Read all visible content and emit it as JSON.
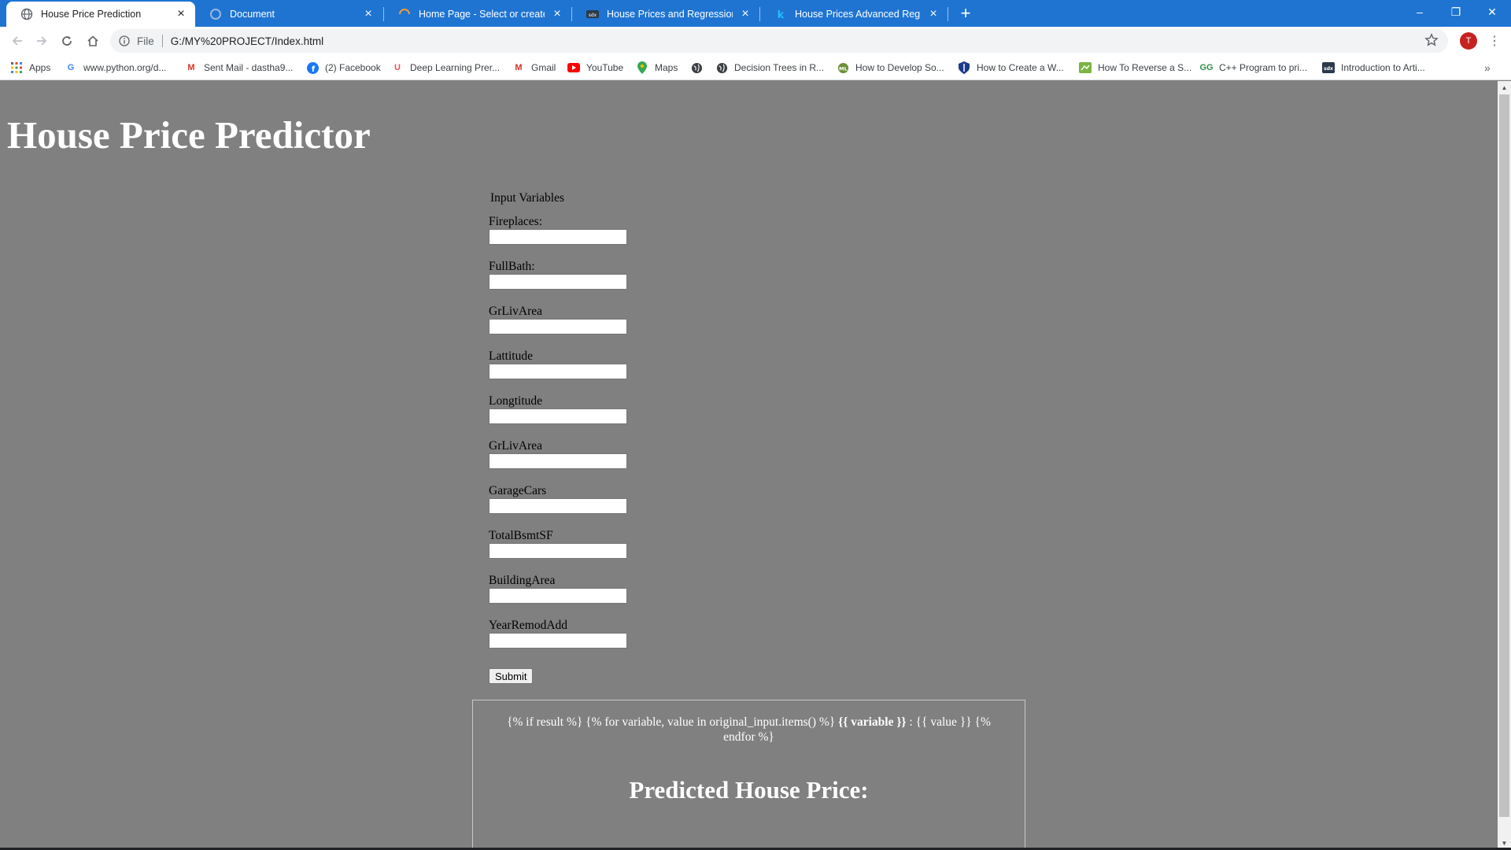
{
  "browser": {
    "tabs": [
      {
        "title": "House Price Prediction",
        "active": true,
        "icon": "globe-icon"
      },
      {
        "title": "Document",
        "active": false,
        "icon": "document-icon"
      },
      {
        "title": "Home Page - Select or create a n",
        "active": false,
        "icon": "loading-icon"
      },
      {
        "title": "House Prices and Regressions. In",
        "active": false,
        "icon": "sdx-icon"
      },
      {
        "title": "House Prices Advanced Regressi",
        "active": false,
        "icon": "kaggle-icon"
      }
    ],
    "new_tab": "+",
    "window_controls": {
      "minimize": "–",
      "restore": "❐",
      "close": "✕"
    },
    "address": {
      "scheme": "File",
      "url": "G:/MY%20PROJECT/Index.html"
    },
    "profile_initial": "T",
    "bookmarks": [
      {
        "label": "Apps",
        "icon": "apps-grid-icon"
      },
      {
        "label": "www.python.org/d...",
        "icon": "google-icon"
      },
      {
        "label": "Sent Mail - dastha9...",
        "icon": "gmail-icon"
      },
      {
        "label": "(2) Facebook",
        "icon": "facebook-icon"
      },
      {
        "label": "Deep Learning Prer...",
        "icon": "udemy-icon"
      },
      {
        "label": "Gmail",
        "icon": "gmail-icon"
      },
      {
        "label": "YouTube",
        "icon": "youtube-icon"
      },
      {
        "label": "Maps",
        "icon": "maps-pin-icon"
      },
      {
        "label": "",
        "icon": "globe-icon"
      },
      {
        "label": "Decision Trees in R...",
        "icon": "globe-icon"
      },
      {
        "label": "How to Develop So...",
        "icon": "machine-learning-mastery-icon"
      },
      {
        "label": "How to Create a W...",
        "icon": "shield-icon"
      },
      {
        "label": "How To Reverse a S...",
        "icon": "stackabuse-icon"
      },
      {
        "label": "C++ Program to pri...",
        "icon": "geeksforgeeks-icon"
      },
      {
        "label": "Introduction to Arti...",
        "icon": "sdx-icon"
      }
    ],
    "bookmarks_overflow": "»"
  },
  "page": {
    "title": "House Price Predictor",
    "form_legend": "Input Variables",
    "fields": [
      {
        "label": "Fireplaces:"
      },
      {
        "label": "FullBath:"
      },
      {
        "label": "GrLivArea"
      },
      {
        "label": "Lattitude"
      },
      {
        "label": "Longtitude"
      },
      {
        "label": "GrLivArea"
      },
      {
        "label": "GarageCars"
      },
      {
        "label": "TotalBsmtSF"
      },
      {
        "label": "BuildingArea"
      },
      {
        "label": "YearRemodAdd"
      }
    ],
    "submit_label": "Submit",
    "result": {
      "template_part1": "{% if result %} {% for variable, value in original_input.items() %}",
      "template_bold": "{{ variable }}",
      "template_part2": ": {{ value }} {% endfor %}",
      "heading": "Predicted House Price:"
    }
  },
  "colors": {
    "tab_strip": "#1f74d2",
    "page_background": "#808080",
    "title_text": "#ffffff"
  }
}
